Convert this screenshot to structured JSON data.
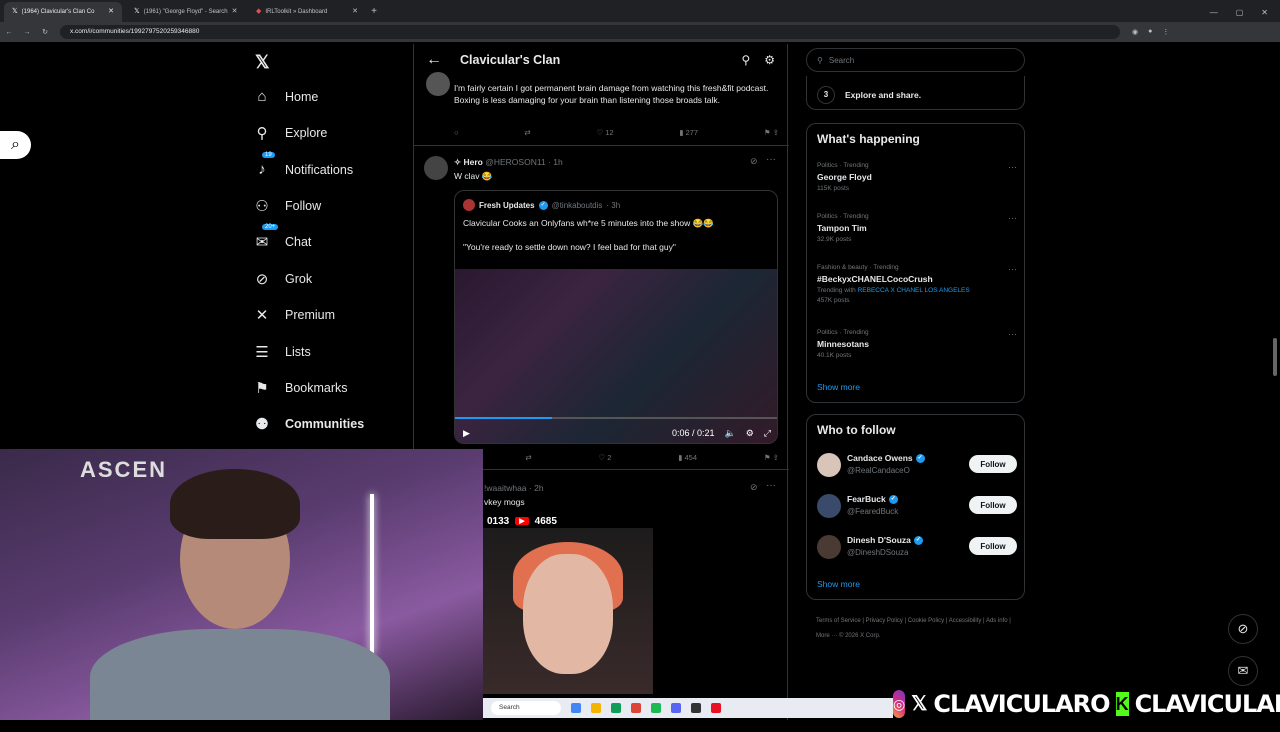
{
  "browser": {
    "tabs": [
      {
        "label": "(1964) Clavicular's Clan Co"
      },
      {
        "label": "(1961) \"George Floyd\" - Search"
      },
      {
        "label": "IRLToolkit » Dashboard"
      }
    ],
    "url": "x.com/i/communities/1992797520259346880"
  },
  "nav": {
    "items": [
      {
        "label": "Home",
        "icon": "home-icon"
      },
      {
        "label": "Explore",
        "icon": "search-icon"
      },
      {
        "label": "Notifications",
        "icon": "bell-icon",
        "badge": "19"
      },
      {
        "label": "Follow",
        "icon": "add-user-icon"
      },
      {
        "label": "Chat",
        "icon": "mail-icon",
        "badge": "20+"
      },
      {
        "label": "Grok",
        "icon": "grok-icon"
      },
      {
        "label": "Premium",
        "icon": "x-icon"
      },
      {
        "label": "Lists",
        "icon": "list-icon"
      },
      {
        "label": "Bookmarks",
        "icon": "bookmark-icon"
      },
      {
        "label": "Communities",
        "icon": "people-icon"
      }
    ]
  },
  "header": {
    "title": "Clavicular's Clan"
  },
  "posts": [
    {
      "text": "I'm fairly certain I got permanent brain damage from watching this fresh&fit podcast. Boxing is less damaging for your brain than listening those broads talk.",
      "likes": "12",
      "views": "277"
    },
    {
      "author": "✧ Hero",
      "handle": "@HEROSON11",
      "time": "· 1h",
      "text": "W clav 😂",
      "quote": {
        "author": "Fresh Updates",
        "handle": "@tinkaboutdis",
        "time": "· 3h",
        "line1": "Clavicular Cooks an Onlyfans wh*re 5 minutes into the show 😂😂",
        "line2": "\"You're ready to settle down now? I feel bad for that guy\"",
        "video_time": "0:06 / 0:21",
        "progress": 0.3
      },
      "likes": "2",
      "views": "454"
    },
    {
      "handle": "!waaitwhaa",
      "time": "· 2h",
      "text": "vkey mogs"
    }
  ],
  "sidebar": {
    "search_placeholder": "Search",
    "step": {
      "num": "3",
      "label": "Explore and share."
    },
    "happening_title": "What's happening",
    "trends": [
      {
        "cat": "Politics · Trending",
        "name": "George Floyd",
        "count": "115K posts"
      },
      {
        "cat": "Politics · Trending",
        "name": "Tampon Tim",
        "count": "32.9K posts"
      },
      {
        "cat": "Fashion & beauty · Trending",
        "name": "#BeckyxCHANELCocoCrush",
        "with_label": "Trending with",
        "with": "REBECCA X CHANEL LOS ANGELES",
        "count": "457K posts"
      },
      {
        "cat": "Politics · Trending",
        "name": "Minnesotans",
        "count": "40.1K posts"
      }
    ],
    "show_more": "Show more",
    "wtf_title": "Who to follow",
    "who_to_follow": [
      {
        "name": "Candace Owens",
        "handle": "@RealCandaceO",
        "btn": "Follow"
      },
      {
        "name": "FearBuck",
        "handle": "@FearedBuck",
        "btn": "Follow"
      },
      {
        "name": "Dinesh D'Souza",
        "handle": "@DineshDSouza",
        "btn": "Follow"
      }
    ],
    "show_more_2": "Show more",
    "footer": "Terms of Service | Privacy Policy | Cookie Policy | Accessibility | Ads info | More ··· © 2026 X Corp."
  },
  "overlay": {
    "webcam_sign": "ASCEN",
    "yt_count_left": "0133",
    "yt_count_right": "4685",
    "yt_label": "▶",
    "brand_text1": "CLAVICULARO",
    "brand_text2": "CLAVICULAR",
    "kick_letter": "K",
    "taskbar_search": "Search"
  }
}
